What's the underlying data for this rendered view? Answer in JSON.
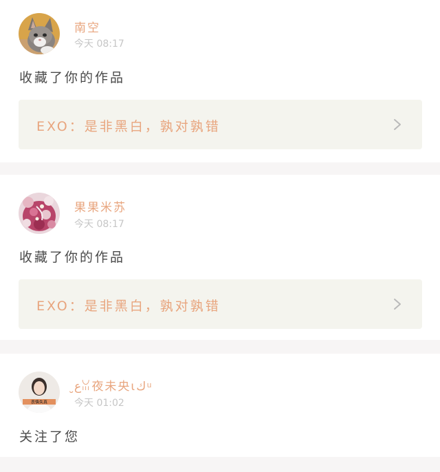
{
  "notifications": [
    {
      "user": "南空",
      "time": "今天 08:17",
      "action": "收藏了你的作品",
      "work_title": "EXO：是非黑白，孰对孰错",
      "avatar_icon": "cat-avatar"
    },
    {
      "user": "果果米苏",
      "time": "今天 08:17",
      "action": "收藏了你的作品",
      "work_title": "EXO：是非黑白，孰对孰错",
      "avatar_icon": "floral-avatar"
    },
    {
      "user": "ﻉ̮ꈍ夜未央ιك ͧ",
      "time": "今天 01:02",
      "action": "关注了您",
      "avatar_icon": "person-avatar",
      "avatar_caption": "表情失真"
    }
  ],
  "colors": {
    "accent": "#e8a57e",
    "time": "#c6c6c6",
    "text": "#4a4a4a",
    "link_bg": "#f4f4ee",
    "divider": "#f7f5f5"
  }
}
